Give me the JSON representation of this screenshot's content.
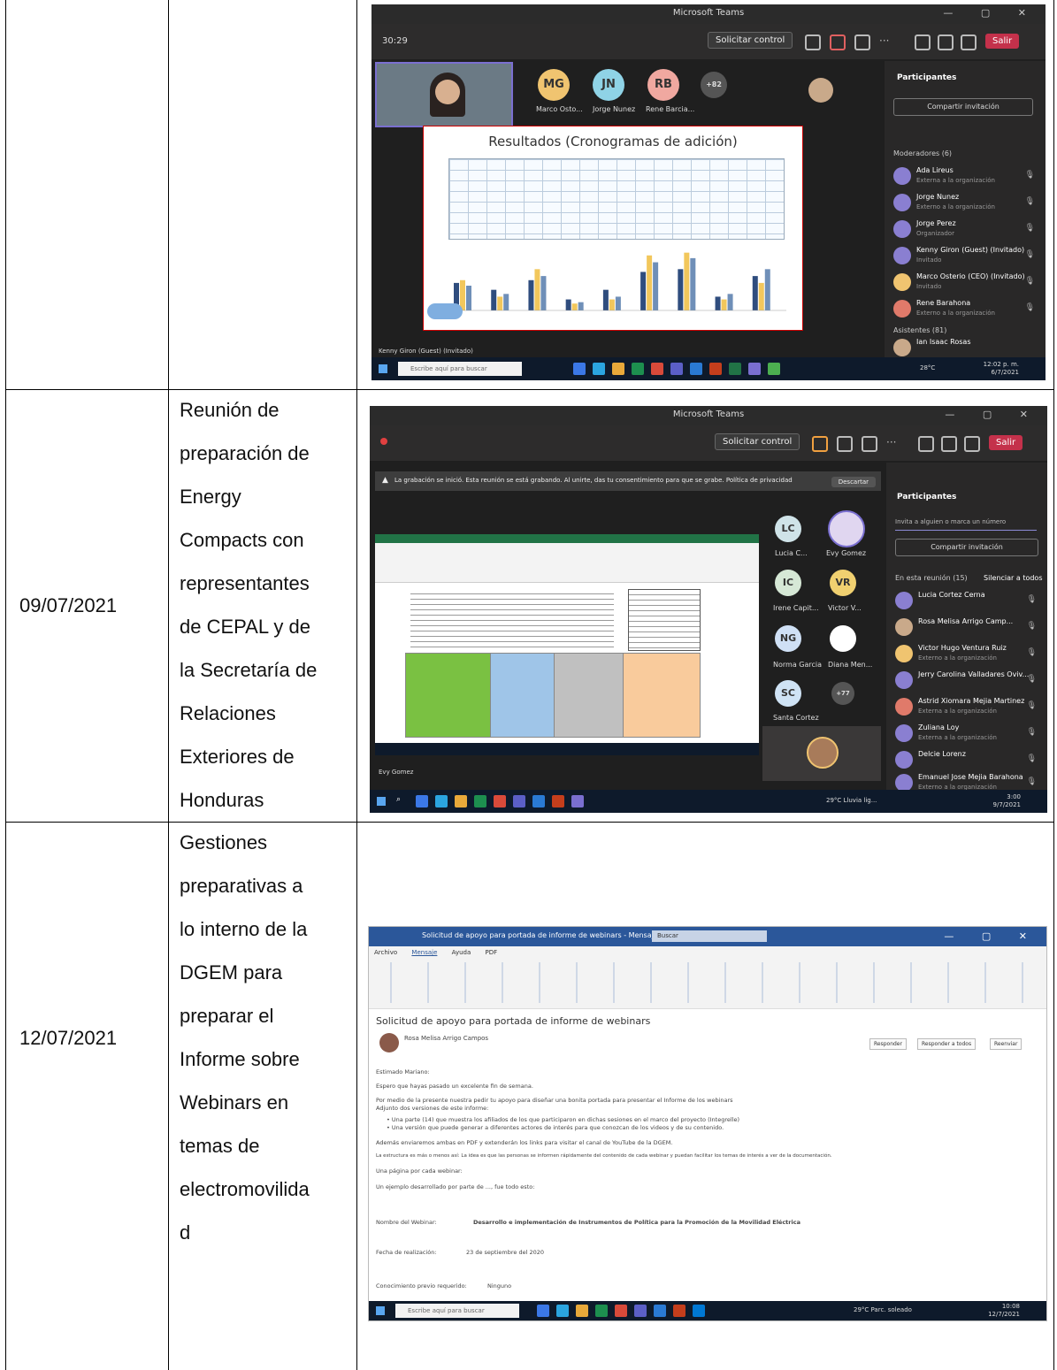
{
  "rows": [
    {
      "date": "",
      "description_lines": [],
      "screenshot": {
        "window_title": "Microsoft Teams",
        "timer": "30:29",
        "request_control": "Solicitar control",
        "leave": "Salir",
        "avatars": [
          {
            "initials": "MG",
            "label": "Marco Osto...",
            "color": "#f0c470"
          },
          {
            "initials": "JN",
            "label": "Jorge Nunez",
            "color": "#8fd3e6"
          },
          {
            "initials": "RB",
            "label": "Rene Barcia...",
            "color": "#f0a8a0"
          },
          {
            "initials": "+82",
            "label": "",
            "color": "#555555"
          }
        ],
        "slide_title": "Resultados (Cronogramas de adición)",
        "presenter_caption": "Kenny Giron (Guest) (Invitado)",
        "panel_title": "Participantes",
        "invite_label": "Compartir invitación",
        "section_moderators": "Moderadores (6)",
        "section_attendees": "Asistentes (81)",
        "participants": [
          {
            "name": "Ada Lireus",
            "sub": "Externa a la organización"
          },
          {
            "name": "Jorge Nunez",
            "sub": "Externo a la organización"
          },
          {
            "name": "Jorge Perez",
            "sub": "Organizador"
          },
          {
            "name": "Kenny Giron (Guest) (Invitado)",
            "sub": "Invitado"
          },
          {
            "name": "Marco Osterio (CEO) (Invitado)",
            "sub": "Invitado"
          },
          {
            "name": "Rene Barahona",
            "sub": "Externo a la organización"
          }
        ],
        "attendee": "Ian Isaac Rosas",
        "taskbar_search": "Escribe aquí para buscar",
        "taskbar_time": "12:02 p. m.",
        "taskbar_date": "6/7/2021",
        "weather": "28°C"
      }
    },
    {
      "date": "09/07/2021",
      "description_lines": [
        "Reunión de",
        "preparación de",
        "Energy",
        "Compacts con",
        "representantes",
        "de CEPAL y de",
        "la Secretaría de",
        "Relaciones",
        "Exteriores de",
        "Honduras"
      ],
      "screenshot": {
        "window_title": "Microsoft Teams",
        "request_control": "Solicitar control",
        "leave": "Salir",
        "banner_text": "La grabación se inició. Esta reunión se está grabando. Al unirte, das tu consentimiento para que se grabe. Política de privacidad",
        "banner_dismiss": "Descartar",
        "panel_title": "Participantes",
        "search_placeholder": "Invita a alguien o marca un número",
        "invite_label": "Compartir invitación",
        "section_meeting": "En esta reunión (15)",
        "mute_all": "Silenciar a todos",
        "avatars": [
          {
            "initials": "LC",
            "label": "Lucia C...",
            "color": "#cfe3e8"
          },
          {
            "initials": "",
            "label": "Evy Gomez",
            "color": "#e0d6f0"
          },
          {
            "initials": "IC",
            "label": "Irene Capit...",
            "color": "#d6e8d6"
          },
          {
            "initials": "VR",
            "label": "Victor V...",
            "color": "#f0d070"
          },
          {
            "initials": "NG",
            "label": "Norma Garcia",
            "color": "#cfe0f5"
          },
          {
            "initials": "",
            "label": "Diana Men...",
            "color": "#ffffff"
          },
          {
            "initials": "SC",
            "label": "Santa Cortez",
            "color": "#cfe3f5"
          },
          {
            "initials": "+77",
            "label": "",
            "color": "#555555"
          }
        ],
        "participants": [
          {
            "name": "Lucia Cortez Cerna",
            "sub": ""
          },
          {
            "name": "Rosa Melisa Arrigo Camp...",
            "sub": ""
          },
          {
            "name": "Victor Hugo Ventura Ruiz",
            "sub": "Externo a la organización"
          },
          {
            "name": "Jerry Carolina Valladares Oviv...",
            "sub": ""
          },
          {
            "name": "Astrid Xiomara Mejia Martinez",
            "sub": "Externa a la organización"
          },
          {
            "name": "Zuliana Loy",
            "sub": "Externa a la organización"
          },
          {
            "name": "Delcie Lorenz",
            "sub": ""
          },
          {
            "name": "Emanuel Jose Mejia Barahona",
            "sub": "Externo a la organización"
          }
        ],
        "self_caption": "Evy Gomez",
        "taskbar_time": "3:00",
        "taskbar_date": "9/7/2021",
        "weather": "29°C Lluvia lig..."
      }
    },
    {
      "date": "12/07/2021",
      "description_lines": [
        "Gestiones",
        "preparativas a",
        "lo interno de la",
        "DGEM para",
        "preparar el",
        "Informe sobre",
        "Webinars en",
        "temas de",
        "electromovilida",
        "d"
      ],
      "screenshot": {
        "window_title": "Solicitud de apoyo para portada de informe de webinars - Mensaje (HTML)",
        "search_label": "Buscar",
        "tabs": [
          "Archivo",
          "Mensaje",
          "Ayuda",
          "PDF"
        ],
        "subject": "Solicitud de apoyo para portada de informe de webinars",
        "sender": "Rosa Melisa Arrigo Campos",
        "reply_buttons": [
          "Responder",
          "Responder a todos",
          "Reenviar"
        ],
        "body_lines": [
          "Estimado Mariano:",
          "Espero que hayas pasado un excelente fin de semana.",
          "Por medio de la presente nuestra pedir tu apoyo para diseñar una bonita portada para presentar el Informe de los webinars",
          "Adjunto dos versiones de este informe:",
          "•  Una parte (14) que muestra los afiliados de los que participaron en dichas sesiones en el marco del proyecto (Integrelle)",
          "•  Una versión que puede generar a diferentes actores de interés para que conozcan de los videos y de su contenido.",
          "Además enviaremos ambas en PDF y extenderán los links para visitar el canal de YouTube de la DGEM.",
          "La estructura es más o menos así: La idea es que las personas se informen rápidamente del contenido de cada webinar y puedan facilitar los temas de interés a ver de la documentación.",
          "Una página por cada webinar:",
          "Un ejemplo desarrollado por parte de ..., fue todo esto:"
        ],
        "field_labels": [
          "Nombre del Webinar:",
          "Fecha de realización:",
          "Conocimiento previo requerido:"
        ],
        "field_values": [
          "Desarrollo e implementación de Instrumentos de Política para la Promoción de la Movilidad Eléctrica",
          "23 de septiembre del 2020",
          "Ninguno"
        ],
        "taskbar_search": "Escribe aquí para buscar",
        "taskbar_time": "10:08",
        "taskbar_date": "12/7/2021",
        "weather": "29°C Parc. soleado"
      }
    }
  ],
  "chart_data": {
    "type": "bar",
    "title": "Resultados (Cronogramas de adición)",
    "series_colors": [
      "#2f4d7e",
      "#f2c75c",
      "#6f8fb8"
    ],
    "series": [
      {
        "values": [
          20,
          15,
          22,
          8,
          15,
          28,
          30,
          10,
          25
        ]
      },
      {
        "values": [
          22,
          10,
          30,
          5,
          8,
          40,
          42,
          8,
          20
        ]
      },
      {
        "values": [
          18,
          12,
          25,
          6,
          10,
          35,
          38,
          12,
          30
        ]
      }
    ]
  }
}
